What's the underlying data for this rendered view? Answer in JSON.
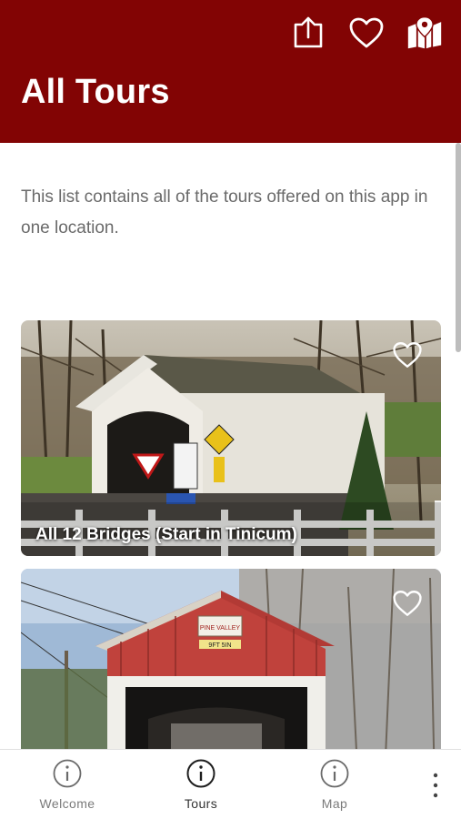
{
  "header": {
    "title": "All Tours",
    "background_color": "#820404",
    "actions": [
      {
        "icon": "share-icon"
      },
      {
        "icon": "heart-icon"
      },
      {
        "icon": "map-pin-icon"
      }
    ]
  },
  "intro": {
    "text": "This list contains all of the tours offered on this app in one location."
  },
  "tours": [
    {
      "title": "All 12 Bridges (Start in Tinicum)",
      "favorite": false,
      "image": "white-covered-bridge"
    },
    {
      "title": "",
      "favorite": false,
      "image": "red-covered-bridge",
      "sign_text": "PINE VALLEY",
      "clearance_text": "9FT 5IN"
    }
  ],
  "bottom_nav": {
    "items": [
      {
        "label": "Welcome",
        "icon": "info-icon",
        "active": false
      },
      {
        "label": "Tours",
        "icon": "info-icon",
        "active": true
      },
      {
        "label": "Map",
        "icon": "info-icon",
        "active": false
      }
    ],
    "more_icon": "more-vertical-icon"
  }
}
